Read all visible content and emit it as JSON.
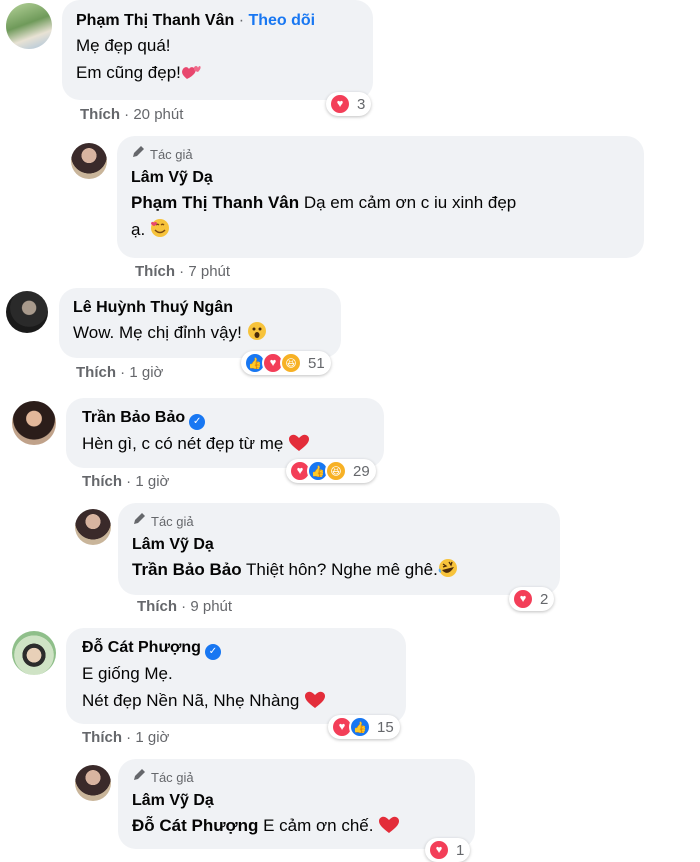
{
  "comments": [
    {
      "name": "Phạm Thị Thanh Vân",
      "follow": "Theo dõi",
      "lines": [
        "Mẹ đẹp quá!",
        "Em cũng đẹp!"
      ],
      "reaction_count": "3",
      "like": "Thích",
      "time": "20 phút"
    },
    {
      "author_tag": "Tác giả",
      "name": "Lâm Vỹ Dạ",
      "mention": "Phạm Thị Thanh Vân",
      "text1": " Dạ em cảm ơn c iu xinh đẹp",
      "text2": "ạ.",
      "like": "Thích",
      "time": "7 phút"
    },
    {
      "name": "Lê Huỳnh Thuý Ngân",
      "text": "Wow. Mẹ chị đỉnh vậy!",
      "reaction_count": "51",
      "like": "Thích",
      "time": "1 giờ"
    },
    {
      "name": "Trần Bảo Bảo",
      "text": "Hèn gì, c có nét đẹp từ mẹ",
      "reaction_count": "29",
      "like": "Thích",
      "time": "1 giờ"
    },
    {
      "author_tag": "Tác giả",
      "name": "Lâm Vỹ Dạ",
      "mention": "Trần Bảo Bảo",
      "text": " Thiệt hôn? Nghe mê ghê.",
      "reaction_count": "2",
      "like": "Thích",
      "time": "9 phút"
    },
    {
      "name": "Đỗ Cát Phượng",
      "lines": [
        "E giống Mẹ.",
        "Nét đẹp Nền Nã, Nhẹ Nhàng"
      ],
      "reaction_count": "15",
      "like": "Thích",
      "time": "1 giờ"
    },
    {
      "author_tag": "Tác giả",
      "name": "Lâm Vỹ Dạ",
      "mention": "Đỗ Cát Phượng",
      "text": " E cảm ơn chế.",
      "reaction_count": "1"
    }
  ],
  "separator": "·",
  "icons": [
    "verified-badge-icon",
    "pencil-icon",
    "love-reaction-icon",
    "like-reaction-icon",
    "haha-reaction-icon"
  ],
  "colors": {
    "accent": "#1877f2",
    "bubble": "#f0f2f5",
    "love": "#f33e58",
    "haha": "#f7b125",
    "meta": "#65676b"
  }
}
